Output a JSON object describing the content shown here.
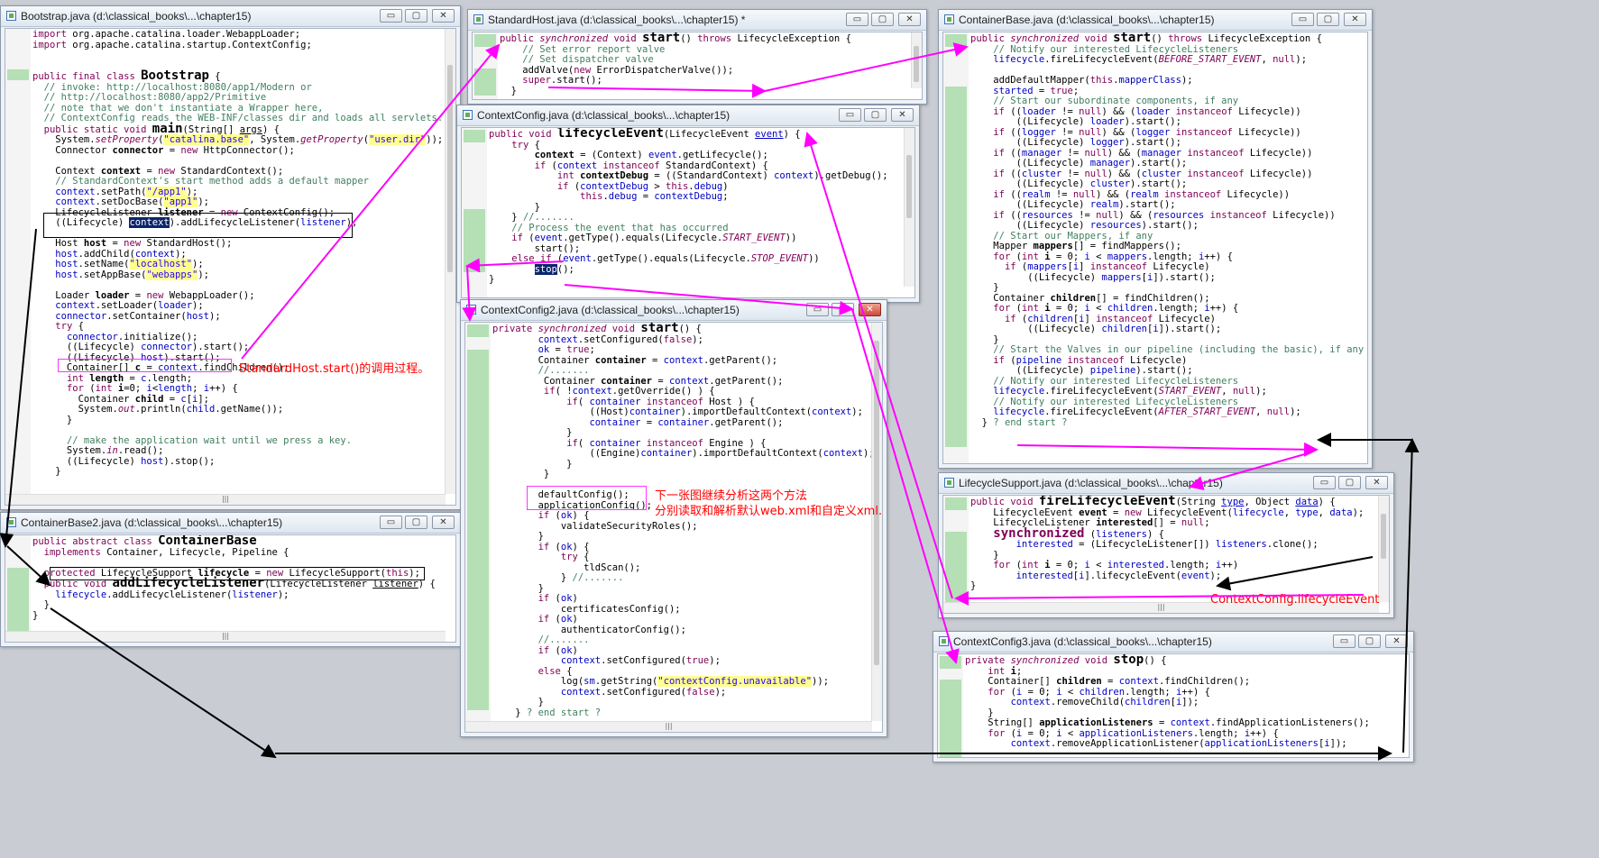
{
  "windows": {
    "bootstrap": {
      "title": "Bootstrap.java (d:\\classical_books\\...\\chapter15)"
    },
    "standardhost": {
      "title": "StandardHost.java (d:\\classical_books\\...\\chapter15) *"
    },
    "containerbase": {
      "title": "ContainerBase.java (d:\\classical_books\\...\\chapter15)"
    },
    "contextconfig": {
      "title": "ContextConfig.java (d:\\classical_books\\...\\chapter15)"
    },
    "contextconfig2": {
      "title": "ContextConfig2.java (d:\\classical_books\\...\\chapter15)"
    },
    "containerbase2": {
      "title": "ContainerBase2.java (d:\\classical_books\\...\\chapter15)"
    },
    "lifecyclesupport": {
      "title": "LifecycleSupport.java (d:\\classical_books\\...\\chapter15)"
    },
    "contextconfig3": {
      "title": "ContextConfig3.java (d:\\classical_books\\...\\chapter15)"
    }
  },
  "window_buttons": {
    "minimize": "▭",
    "maximize": "▢",
    "close": "✕"
  },
  "scroll_grip": "|||",
  "annotations": {
    "standardhost_start": "StandardHost.start()的调用过程。",
    "next_image_line1": "下一张图继续分析这两个方法",
    "next_image_line2": "分别读取和解析默认web.xml和自定义xml.",
    "lifecycle_event": "ContextConfig.lifecycleEvent"
  },
  "colors": {
    "arrow": "#ff00ff",
    "annotation": "#ff0000"
  }
}
